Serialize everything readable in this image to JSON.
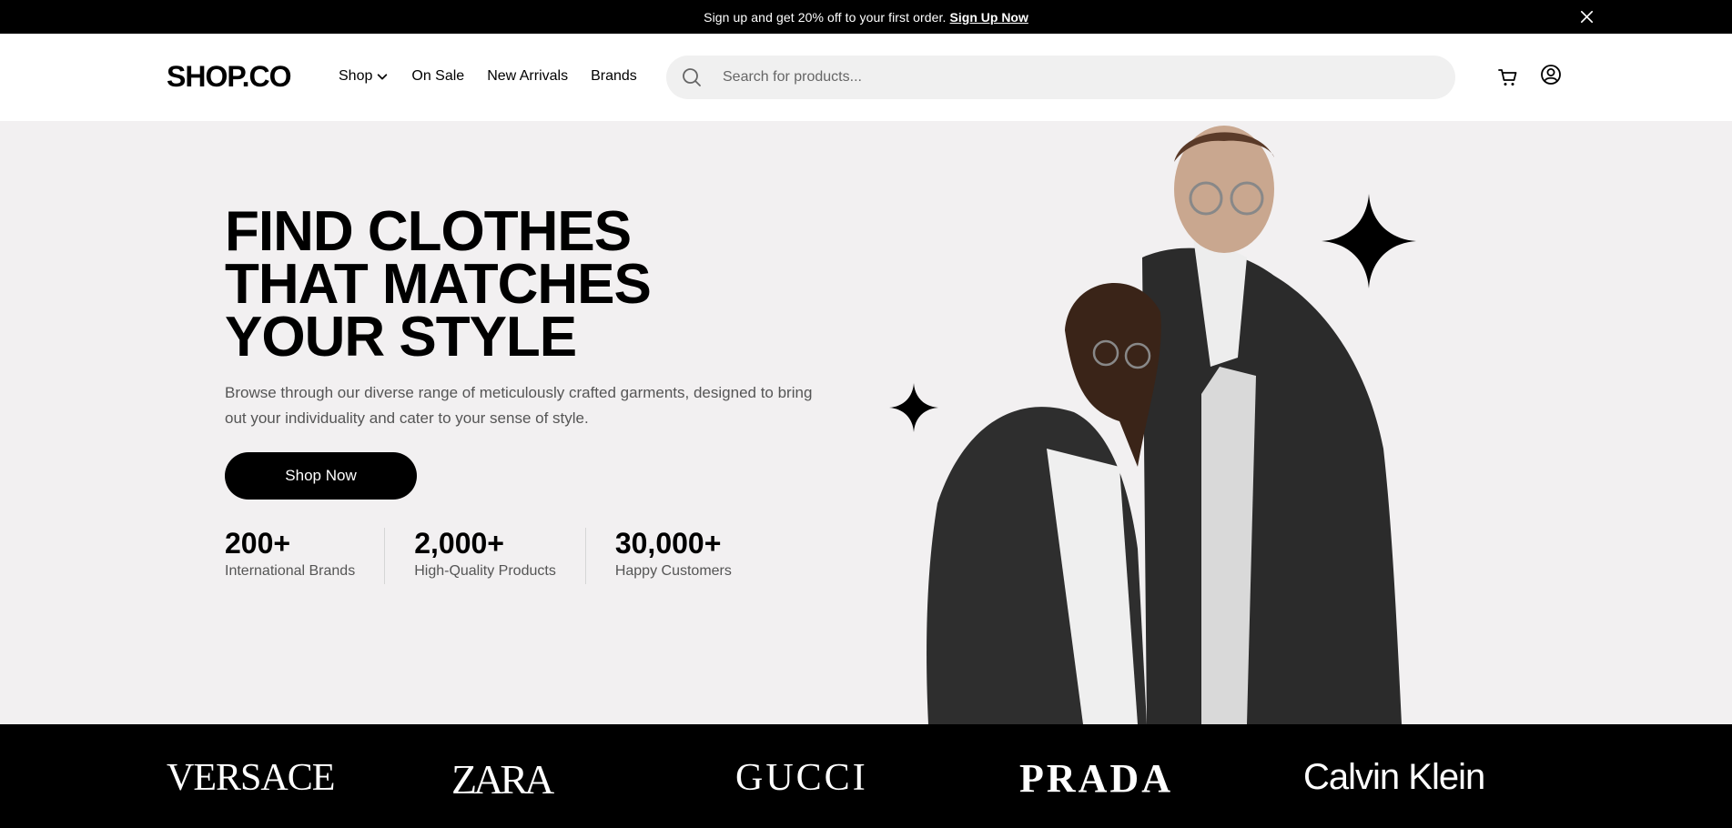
{
  "topbar": {
    "promo_text": "Sign up and get 20% off to your first order.",
    "signup_link": "Sign Up Now"
  },
  "header": {
    "logo": "SHOP.CO",
    "nav": [
      "Shop",
      "On Sale",
      "New Arrivals",
      "Brands"
    ],
    "search_placeholder": "Search for products..."
  },
  "hero": {
    "title_lines": [
      "FIND CLOTHES",
      "THAT MATCHES",
      "YOUR STYLE"
    ],
    "description": "Browse through our diverse range of meticulously crafted garments, designed to bring out your individuality and cater to your sense of style.",
    "cta": "Shop Now",
    "stats": [
      {
        "value": "200+",
        "label": "International Brands"
      },
      {
        "value": "2,000+",
        "label": "High-Quality Products"
      },
      {
        "value": "30,000+",
        "label": "Happy Customers"
      }
    ]
  },
  "brands": [
    "VERSACE",
    "ZARA",
    "GUCCI",
    "PRADA",
    "Calvin Klein"
  ],
  "colors": {
    "primary": "#000000",
    "hero_bg": "#f2f0f1",
    "search_bg": "#f0f0f0"
  },
  "icons": [
    "close-icon",
    "chevron-down-icon",
    "search-icon",
    "cart-icon",
    "user-circle-icon",
    "sparkle-star-icon"
  ]
}
